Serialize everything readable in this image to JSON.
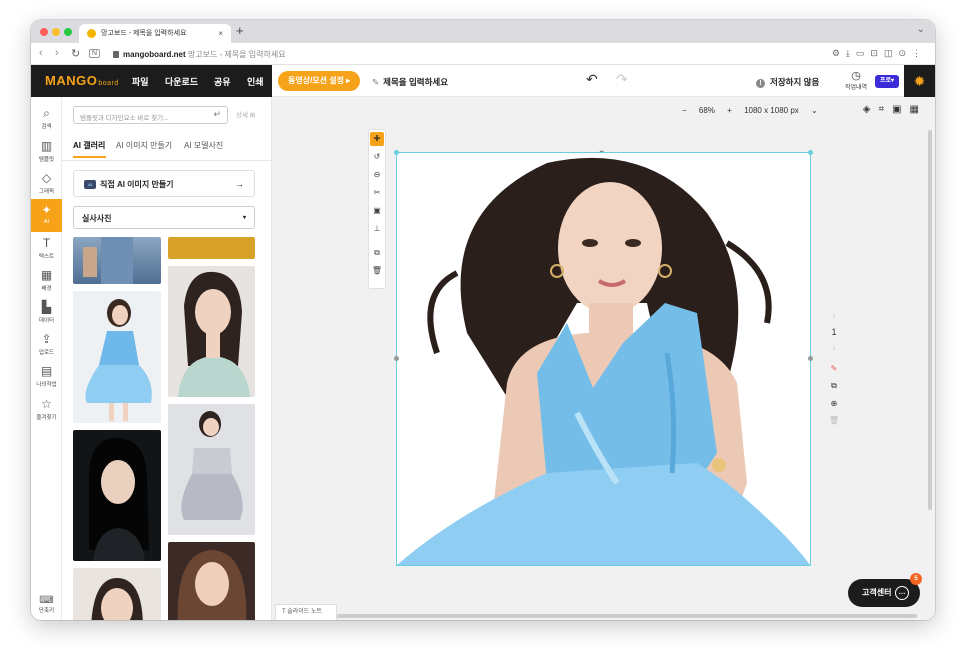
{
  "browser": {
    "tab_title": "망고보드 - 제목을 입력하세요",
    "tab_close": "×",
    "new_tab": "+",
    "url_domain": "mangoboard.net",
    "url_title": "망고보드 - 제목을 입력하세요",
    "back": "‹",
    "forward": "›",
    "reload": "↻"
  },
  "app": {
    "logo": "MANGO",
    "logo_sub": "board",
    "menu": [
      "파일",
      "다운로드",
      "공유",
      "인쇄"
    ],
    "motion_button": "동영상/모션 설정 ▸",
    "title_placeholder": "제목을 입력하세요",
    "undo": "↶",
    "redo": "↷",
    "save_status": "저장하지 않음",
    "history_label": "작업내역",
    "plan_badge": "프로",
    "colors": {
      "accent": "#f6a319",
      "dark": "#1c1c1c",
      "selection": "#6ccde0",
      "pro": "#3b2bd8"
    }
  },
  "rail": [
    {
      "label": "검색",
      "icon": "search-icon",
      "glyph": "⌕"
    },
    {
      "label": "템플릿",
      "icon": "template-icon",
      "glyph": "▥"
    },
    {
      "label": "그래픽",
      "icon": "graphic-icon",
      "glyph": "◇"
    },
    {
      "label": "AI",
      "icon": "ai-icon",
      "glyph": "✦",
      "active": true
    },
    {
      "label": "텍스트",
      "icon": "text-icon",
      "glyph": "T"
    },
    {
      "label": "배경",
      "icon": "background-icon",
      "glyph": "▦"
    },
    {
      "label": "데이터",
      "icon": "chart-icon",
      "glyph": "▙"
    },
    {
      "label": "업로드",
      "icon": "upload-icon",
      "glyph": "⇪"
    },
    {
      "label": "나의작업",
      "icon": "my-work-icon",
      "glyph": "▤"
    },
    {
      "label": "즐겨찾기",
      "icon": "star-icon",
      "glyph": "☆"
    }
  ],
  "shortcut": {
    "label": "단축키",
    "glyph": "⌨"
  },
  "panel": {
    "search_placeholder": "템플릿과 디자인요소 바로 찾기...",
    "detail_label": "상세",
    "tabs": [
      "AI 갤러리",
      "AI 이미지 만들기",
      "AI 모델사진"
    ],
    "badge": "AI",
    "make_button": "직접 AI 이미지 만들기",
    "make_arrow": "→",
    "category": "실사사진",
    "category_caret": "▾"
  },
  "workspace": {
    "zoom_minus": "−",
    "zoom": "68%",
    "zoom_plus": "+",
    "size": "1080 x 1080 px",
    "page_number": "1",
    "note_label": "슬라이드 노트",
    "help_label": "고객센터",
    "help_badge": "5"
  }
}
